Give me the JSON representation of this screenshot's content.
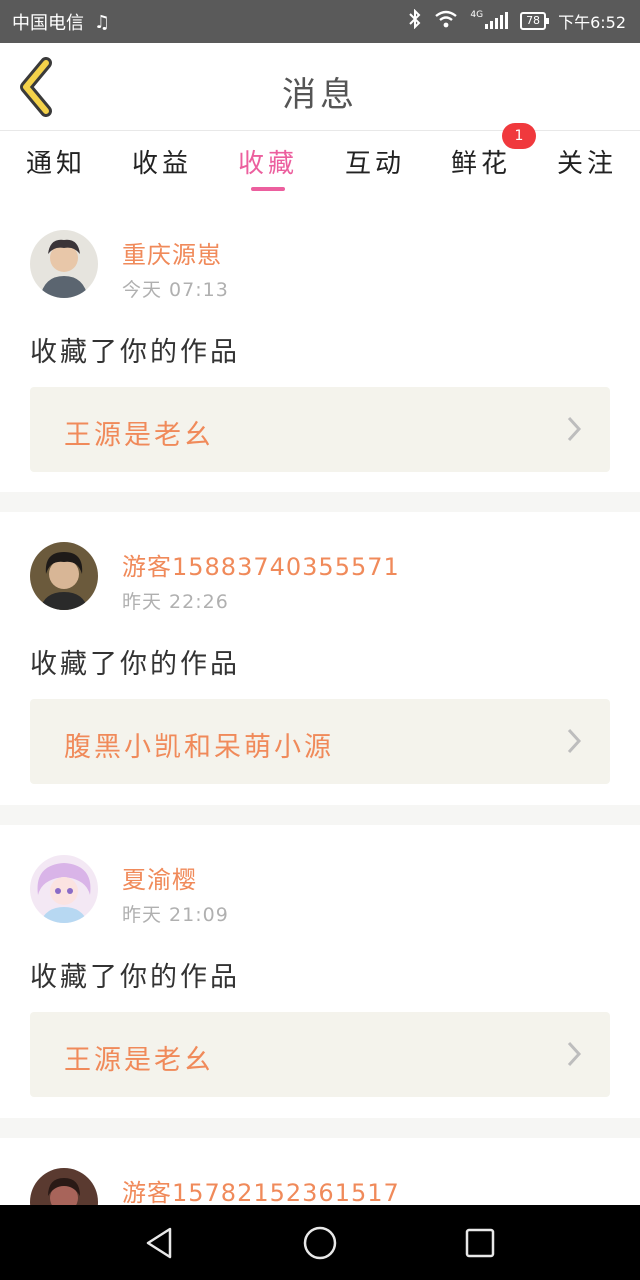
{
  "status_bar": {
    "carrier": "中国电信",
    "music_icon": "music-note-icon",
    "network": "4G",
    "battery": "78",
    "time": "下午6:52"
  },
  "header": {
    "title": "消息",
    "back_icon": "chevron-left-icon"
  },
  "tabs": [
    {
      "label": "通知"
    },
    {
      "label": "收益"
    },
    {
      "label": "收藏",
      "active": true
    },
    {
      "label": "互动"
    },
    {
      "label": "鲜花",
      "badge": "1"
    },
    {
      "label": "关注"
    }
  ],
  "colors": {
    "accent_pink": "#ec5f9e",
    "name_orange": "#f08a5a",
    "badge_red": "#f0393d",
    "work_bg": "#f4f3ec"
  },
  "items": [
    {
      "user": "重庆源崽",
      "time": "今天 07:13",
      "action": "收藏了你的作品",
      "work": "王源是老幺"
    },
    {
      "user": "游客15883740355571",
      "time": "昨天 22:26",
      "action": "收藏了你的作品",
      "work": "腹黑小凯和呆萌小源"
    },
    {
      "user": "夏渝樱",
      "time": "昨天 21:09",
      "action": "收藏了你的作品",
      "work": "王源是老幺"
    },
    {
      "user": "游客15782152361517"
    }
  ],
  "nav_bar": {
    "back": "triangle-back-icon",
    "home": "circle-home-icon",
    "recents": "square-recents-icon"
  }
}
